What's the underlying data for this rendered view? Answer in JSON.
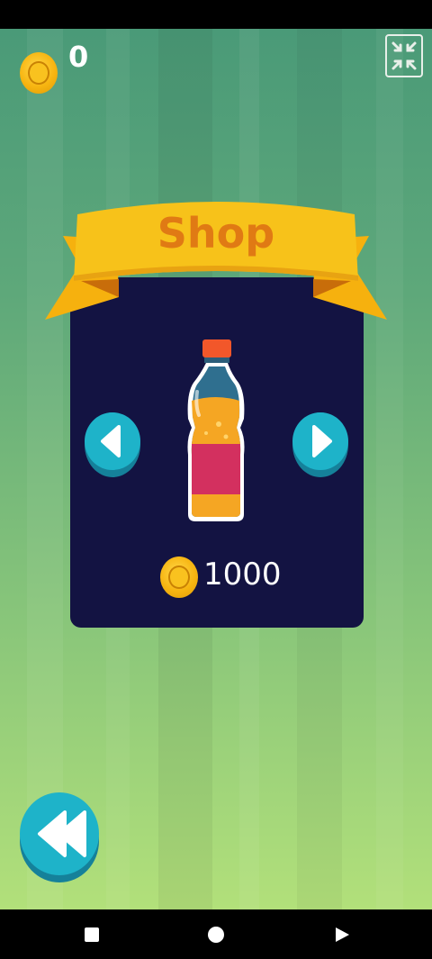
{
  "hud": {
    "coins": "0",
    "coin_icon": "coin-icon",
    "fullscreen_icon": "exit-fullscreen-icon"
  },
  "shop": {
    "title": "Shop",
    "item": {
      "name_icon": "soda-bottle-icon",
      "price": "1000"
    },
    "prev_icon": "chevron-left-icon",
    "next_icon": "chevron-right-icon"
  },
  "back_icon": "back-arrow-icon",
  "navigation": {
    "recents_icon": "square-icon",
    "home_icon": "circle-icon",
    "back_icon": "triangle-back-icon"
  },
  "colors": {
    "panel": "#131342",
    "ribbon": "#f7c21a",
    "ribbon_dark": "#e8920f",
    "title": "#e07a14",
    "button": "#1eb3c9",
    "bottle_liquid": "#f5a623",
    "bottle_label": "#d3305f"
  }
}
